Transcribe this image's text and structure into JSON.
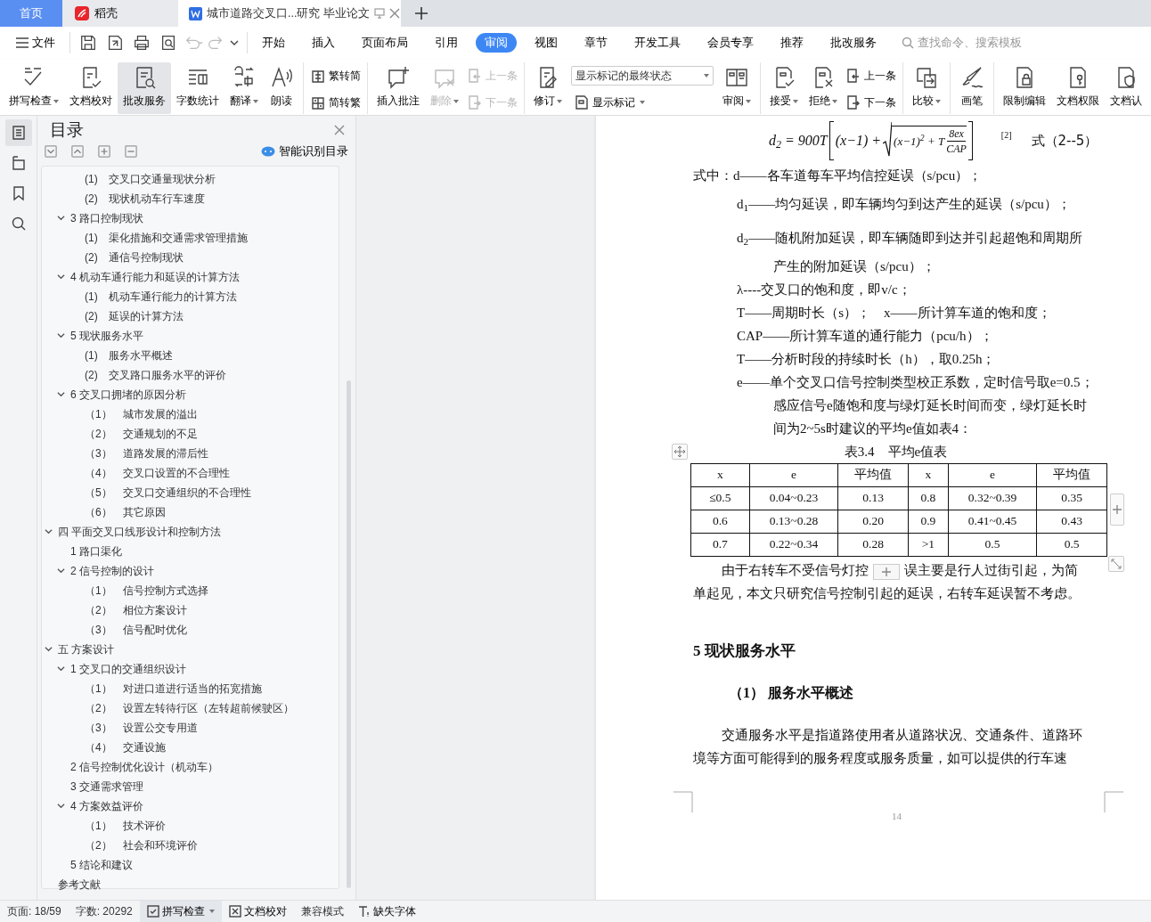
{
  "tabs": [
    {
      "kind": "home",
      "label": "首页",
      "selected": false
    },
    {
      "kind": "app",
      "label": "稻壳",
      "selected": false
    },
    {
      "kind": "document",
      "label": "城市道路交叉口...研究 毕业论文",
      "selected": true
    }
  ],
  "menu": {
    "file": "文件",
    "tabs": [
      {
        "label": "开始",
        "selected": false
      },
      {
        "label": "插入",
        "selected": false
      },
      {
        "label": "页面布局",
        "selected": false
      },
      {
        "label": "引用",
        "selected": false
      },
      {
        "label": "审阅",
        "selected": true
      },
      {
        "label": "视图",
        "selected": false
      },
      {
        "label": "章节",
        "selected": false
      },
      {
        "label": "开发工具",
        "selected": false
      },
      {
        "label": "会员专享",
        "selected": false
      },
      {
        "label": "推荐",
        "selected": false
      },
      {
        "label": "批改服务",
        "selected": false
      }
    ],
    "search": {
      "placeholder": "查找命令、搜索模板"
    }
  },
  "ribbon": [
    {
      "kind": "large",
      "label": "拼写检查",
      "dropdown": true,
      "disabled": false,
      "highlighted": false
    },
    {
      "kind": "large",
      "label": "文档校对",
      "dropdown": false,
      "disabled": false,
      "highlighted": false
    },
    {
      "kind": "large",
      "label": "批改服务",
      "dropdown": false,
      "disabled": false,
      "highlighted": true
    },
    {
      "kind": "large",
      "label": "字数统计",
      "dropdown": false,
      "disabled": false,
      "highlighted": false
    },
    {
      "kind": "large",
      "label": "翻译",
      "dropdown": true,
      "disabled": false,
      "highlighted": false
    },
    {
      "kind": "large",
      "label": "朗读",
      "dropdown": false,
      "disabled": false,
      "highlighted": false
    },
    {
      "kind": "separator"
    },
    {
      "kind": "pair",
      "rows": [
        {
          "label": "繁转简",
          "disabled": false
        },
        {
          "label": "简转繁",
          "disabled": false
        }
      ]
    },
    {
      "kind": "separator"
    },
    {
      "kind": "large",
      "label": "插入批注",
      "dropdown": false,
      "disabled": false,
      "highlighted": false
    },
    {
      "kind": "large",
      "label": "删除",
      "dropdown": true,
      "disabled": true,
      "highlighted": false
    },
    {
      "kind": "pair",
      "rows": [
        {
          "label": "上一条",
          "disabled": true
        },
        {
          "label": "下一条",
          "disabled": true
        }
      ]
    },
    {
      "kind": "separator"
    },
    {
      "kind": "large",
      "label": "修订",
      "dropdown": true,
      "disabled": false,
      "highlighted": false
    },
    {
      "kind": "markup",
      "value": "显示标记的最终状态",
      "label": "显示标记"
    },
    {
      "kind": "large",
      "label": "审阅",
      "dropdown": true,
      "disabled": false,
      "highlighted": false
    },
    {
      "kind": "separator"
    },
    {
      "kind": "large",
      "label": "接受",
      "dropdown": true,
      "disabled": false,
      "highlighted": false
    },
    {
      "kind": "large",
      "label": "拒绝",
      "dropdown": true,
      "disabled": false,
      "highlighted": false
    },
    {
      "kind": "pair",
      "rows": [
        {
          "label": "上一条",
          "disabled": false
        },
        {
          "label": "下一条",
          "disabled": false
        }
      ]
    },
    {
      "kind": "separator"
    },
    {
      "kind": "large",
      "label": "比较",
      "dropdown": true,
      "disabled": false,
      "highlighted": false
    },
    {
      "kind": "separator"
    },
    {
      "kind": "large",
      "label": "画笔",
      "dropdown": false,
      "disabled": false,
      "highlighted": false
    },
    {
      "kind": "separator"
    },
    {
      "kind": "large",
      "label": "限制编辑",
      "dropdown": false,
      "disabled": false,
      "highlighted": false
    },
    {
      "kind": "large",
      "label": "文档权限",
      "dropdown": false,
      "disabled": false,
      "highlighted": false
    },
    {
      "kind": "large",
      "label": "文档认",
      "dropdown": false,
      "disabled": false,
      "highlighted": false
    }
  ],
  "rail": [
    {
      "selected": true
    },
    {
      "selected": false
    },
    {
      "selected": false
    },
    {
      "selected": false
    }
  ],
  "toc": {
    "title": "目录",
    "smart_button": "智能识别目录",
    "items": [
      {
        "children": [
          {
            "children": [
              {
                "label": "(1)　交叉口交通量现状分析"
              },
              {
                "label": "(2)　现状机动车行车速度"
              }
            ]
          },
          {
            "label": "3  路口控制现状",
            "expanded": true,
            "children": [
              {
                "label": "(1)　渠化措施和交通需求管理措施"
              },
              {
                "label": "(2)　通信号控制现状"
              }
            ]
          },
          {
            "label": "4  机动车通行能力和延误的计算方法",
            "expanded": true,
            "children": [
              {
                "label": "(1)　机动车通行能力的计算方法"
              },
              {
                "label": "(2)　延误的计算方法"
              }
            ]
          },
          {
            "label": "5  现状服务水平",
            "expanded": true,
            "children": [
              {
                "label": "(1)　服务水平概述"
              },
              {
                "label": "(2)　交叉路口服务水平的评价"
              }
            ]
          },
          {
            "label": "6  交叉口拥堵的原因分析",
            "expanded": true,
            "children": [
              {
                "label": "（1）　城市发展的溢出"
              },
              {
                "label": "（2）　交通规划的不足"
              },
              {
                "label": "（3）　道路发展的滞后性"
              },
              {
                "label": "（4）　交叉口设置的不合理性"
              },
              {
                "label": "（5）　交叉口交通组织的不合理性"
              },
              {
                "label": "（6）　其它原因"
              }
            ]
          }
        ]
      },
      {
        "label": "四  平面交叉口线形设计和控制方法",
        "expanded": true,
        "children": [
          {
            "label": "1  路口渠化"
          },
          {
            "label": "2  信号控制的设计",
            "expanded": true,
            "children": [
              {
                "label": "（1）　信号控制方式选择"
              },
              {
                "label": "（2）　相位方案设计"
              },
              {
                "label": "（3）　信号配时优化"
              }
            ]
          }
        ]
      },
      {
        "label": "五  方案设计",
        "expanded": true,
        "children": [
          {
            "label": "1  交叉口的交通组织设计",
            "expanded": true,
            "children": [
              {
                "label": "（1）　对进口道进行适当的拓宽措施"
              },
              {
                "label": "（2）　设置左转待行区（左转超前候驶区）"
              },
              {
                "label": "（3）　设置公交专用道"
              },
              {
                "label": "（4）　交通设施"
              }
            ]
          },
          {
            "label": "2  信号控制优化设计（机动车）"
          },
          {
            "label": "3  交通需求管理"
          },
          {
            "label": "4  方案效益评价",
            "expanded": true,
            "children": [
              {
                "label": "（1）　技术评价"
              },
              {
                "label": "（2）　社会和环境评价"
              }
            ]
          },
          {
            "label": "5  结论和建议"
          }
        ]
      },
      {
        "label": "参考文献"
      }
    ]
  },
  "document": {
    "formula": {
      "lhs": "d$_{2}$ = 900T",
      "term": "(x−1) +",
      "radicand": "(x−1)$^{2}$ + T",
      "numerator": "8ex",
      "denominator": "CAP",
      "citation": "[2]",
      "label": "式（2--5）"
    },
    "lines": [
      {
        "kind": "lead",
        "text": "式中：d——各车道每车平均信控延误（s/pcu）；"
      },
      {
        "kind": "variable",
        "text": "d$_{1}$——均匀延误，即车辆均匀到达产生的延误（s/pcu）；"
      },
      {
        "kind": "variable",
        "text": "d$_{2}$——随机附加延误，即车辆随即到达并引起超饱和周期所"
      },
      {
        "kind": "continuation",
        "text": "产生的附加延误（s/pcu）；"
      },
      {
        "kind": "item",
        "text": "λ----交叉口的饱和度，即v/c；"
      },
      {
        "kind": "item",
        "text": "T——周期时长（s）；　x——所计算车道的饱和度；"
      },
      {
        "kind": "item",
        "text": "CAP——所计算车道的通行能力（pcu/h）；"
      },
      {
        "kind": "item",
        "text": "T——分析时段的持续时长（h），取0.25h；"
      },
      {
        "kind": "item",
        "text": "e——单个交叉口信号控制类型校正系数，定时信号取e=0.5；"
      },
      {
        "kind": "continuation",
        "text": "感应信号e随饱和度与绿灯延长时间而变，绿灯延长时"
      },
      {
        "kind": "continuation",
        "text": "间为2~5s时建议的平均e值如表4："
      }
    ],
    "table": {
      "caption": "表3.4　平均e值表",
      "columns": [
        "x",
        "e",
        "平均值",
        "x",
        "e",
        "平均值"
      ],
      "rows": [
        [
          "≤0.5",
          "0.04~0.23",
          "0.13",
          "0.8",
          "0.32~0.39",
          "0.35"
        ],
        [
          "0.6",
          "0.13~0.28",
          "0.20",
          "0.9",
          "0.41~0.45",
          "0.43"
        ],
        [
          "0.7",
          "0.22~0.34",
          "0.28",
          ">1",
          "0.5",
          "0.5"
        ]
      ]
    },
    "paragraph_1": {
      "before_button": "由于右转车不受信号灯控",
      "after_button": "误主要是行人过街引起，为简",
      "line_2": "单起见，本文只研究信号控制引起的延误，右转车延误暂不考虑。"
    },
    "heading": "5  现状服务水平",
    "subheading": "（1）  服务水平概述",
    "paragraph_2": [
      "交通服务水平是指道路使用者从道路状况、交通条件、道路环",
      "境等方面可能得到的服务程度或服务质量，如可以提供的行车速"
    ],
    "page_number": "14"
  },
  "status_bar": {
    "page": "页面: 18/59",
    "words": "字数: 20292",
    "spell": "拼写检查",
    "proof": "文档校对",
    "mode": "兼容模式",
    "fonts": "缺失字体"
  }
}
